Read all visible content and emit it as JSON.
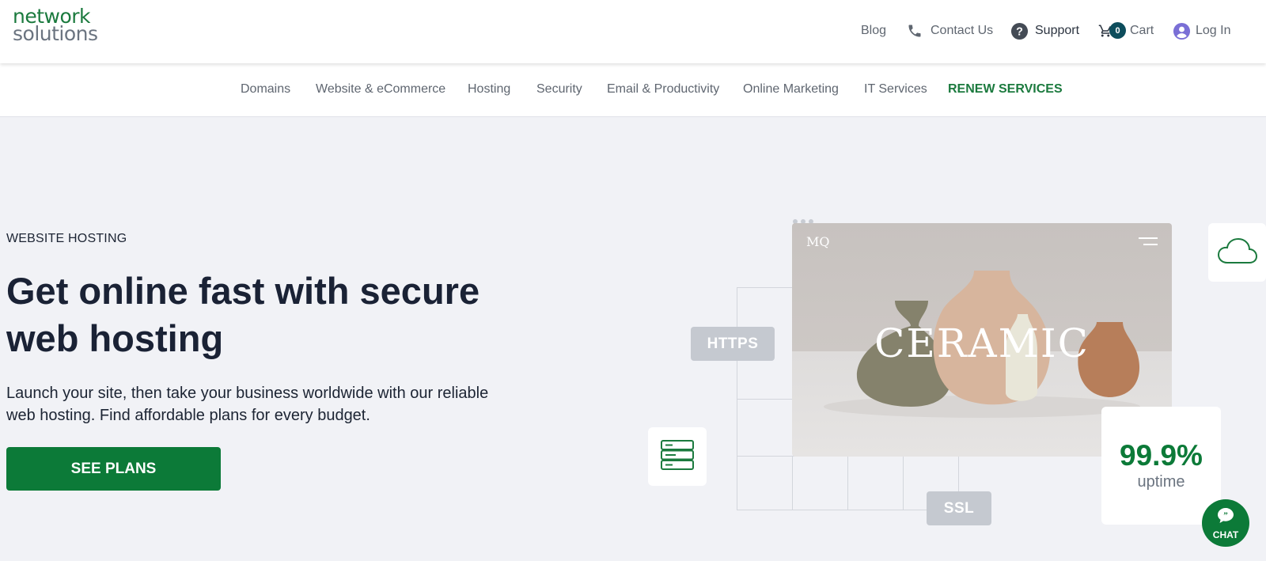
{
  "brand": {
    "line1": "network",
    "line2": "solutions"
  },
  "utility": {
    "blog": "Blog",
    "contact": "Contact Us",
    "support": "Support",
    "cart": "Cart",
    "cart_count": "0",
    "login": "Log In"
  },
  "nav": {
    "items": [
      "Domains",
      "Website & eCommerce",
      "Hosting",
      "Security",
      "Email & Productivity",
      "Online Marketing",
      "IT Services",
      "RENEW SERVICES"
    ]
  },
  "hero": {
    "eyebrow": "WEBSITE HOSTING",
    "headline": "Get online fast with secure web hosting",
    "subtext": "Launch your site, then take your business worldwide with our reliable web hosting. Find affordable plans for every budget.",
    "cta": "SEE PLANS"
  },
  "illustration": {
    "mock_brand": "MQ",
    "mock_word": "CERAMIC",
    "https": "HTTPS",
    "ssl": "SSL",
    "uptime_value": "99.9%",
    "uptime_label": "uptime"
  },
  "chat": {
    "label": "CHAT"
  },
  "colors": {
    "brand_green": "#0c7a38",
    "text_dark": "#1a2235",
    "badge": "#0d4d5c",
    "background": "#f1f2f6"
  },
  "icons": [
    "phone-icon",
    "support-icon",
    "cart-icon",
    "user-icon",
    "server-icon",
    "cloud-icon",
    "chat-icon",
    "menu-icon"
  ]
}
